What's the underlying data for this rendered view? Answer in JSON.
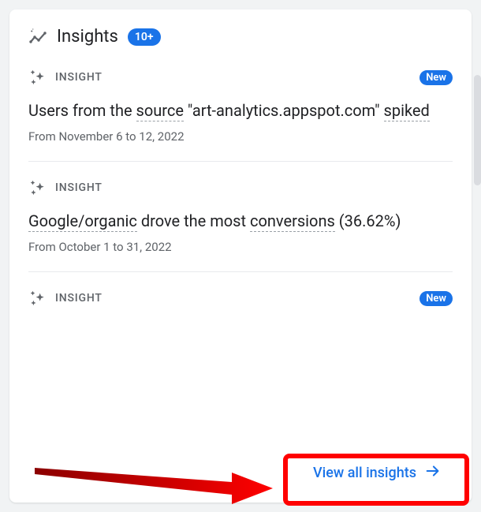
{
  "header": {
    "title": "Insights",
    "badge": "10+"
  },
  "insights": [
    {
      "label": "INSIGHT",
      "isNew": true,
      "newLabel": "New",
      "titleParts": {
        "p1": "Users from the ",
        "p2": "source",
        "p3": " \"art-analytics.appspot.com\" ",
        "p4": "spiked"
      },
      "dateRange": "From November 6 to 12, 2022"
    },
    {
      "label": "INSIGHT",
      "isNew": false,
      "titleParts": {
        "p1": "Google/organic",
        "p2": " drove the most ",
        "p3": "conversions",
        "p4": " (36.62%)"
      },
      "dateRange": "From October 1 to 31, 2022"
    },
    {
      "label": "INSIGHT",
      "isNew": true,
      "newLabel": "New"
    }
  ],
  "footer": {
    "viewAll": "View all insights"
  },
  "colors": {
    "accent": "#1a73e8",
    "annotation": "#ff0000"
  }
}
